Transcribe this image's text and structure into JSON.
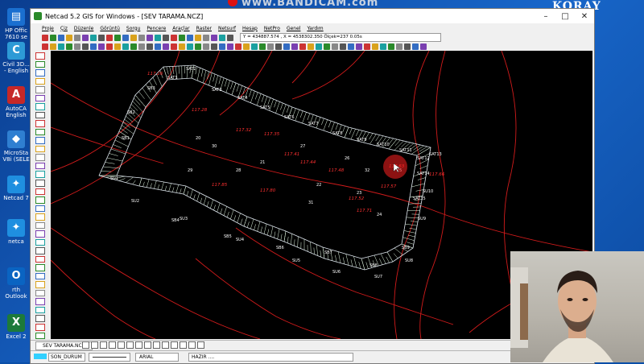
{
  "recording": {
    "watermark": "www.BANDICAM.com"
  },
  "channel": {
    "name": "KORAY ZENG"
  },
  "desktop": {
    "icons": [
      {
        "label": "HP Offic 7610 se",
        "color": "#1a6fd0",
        "glyph": "▤"
      },
      {
        "label": "Civil 3D... - English",
        "color": "#2d9ad6",
        "glyph": "C"
      },
      {
        "label": "AutoCA English",
        "color": "#c62828",
        "glyph": "A"
      },
      {
        "label": "MicroSta V8i (SELE",
        "color": "#2f7fd1",
        "glyph": "◆"
      },
      {
        "label": "Netcad 7",
        "color": "#1f8fe0",
        "glyph": "✦"
      },
      {
        "label": "netca",
        "color": "#1f8fe0",
        "glyph": "✦"
      },
      {
        "label": "rth Outlook",
        "color": "#0a64c2",
        "glyph": "O"
      },
      {
        "label": "Excel 2",
        "color": "#1d7a3a",
        "glyph": "X"
      }
    ]
  },
  "window": {
    "title": "Netcad 5.2 GIS for Windows - [SEV TARAMA.NCZ]",
    "menu": [
      "Proje",
      "Çiz",
      "Düzenle",
      "Görüntü",
      "Sorgu",
      "Pencere",
      "Araçlar",
      "Raster",
      "Netsurf",
      "Hesap",
      "NetPro",
      "Genel",
      "Yardım"
    ],
    "coordinates": "Y = 434887.574 , X = 4538302.350  Ölçek=237   0.05s",
    "document_tab": "SEV TARAMA.NCZ",
    "status": {
      "layer_color": "#32d0ff",
      "layer": "SON_DURUM",
      "font": "ARIAL",
      "message": "HAZIR ...."
    }
  },
  "drawing": {
    "point_labels": [
      "SAT1",
      "SAT2",
      "SAT3",
      "SAT4",
      "SAT5",
      "SAT6",
      "SAT7",
      "SAT8",
      "SAT9",
      "SAT10",
      "SAT11",
      "SAT12",
      "SAT13",
      "SAT14",
      "SAT15",
      "SU1",
      "SU2",
      "SU3",
      "SU4",
      "SU5",
      "SU6",
      "SU7",
      "SU8",
      "SU9",
      "SU10",
      "SB1",
      "SB2",
      "SB3",
      "SB4",
      "SB5",
      "SB6",
      "SB7",
      "SB8",
      "SB9"
    ],
    "numbers": [
      "20",
      "21",
      "22",
      "23",
      "24",
      "25",
      "26",
      "27",
      "28",
      "29",
      "30",
      "31",
      "32"
    ],
    "elevations": [
      "117.26",
      "117.28",
      "117.32",
      "117.35",
      "117.41",
      "117.44",
      "117.48",
      "117.52",
      "117.57",
      "117.63",
      "117.66",
      "117.71",
      "117.80",
      "117.85"
    ]
  }
}
